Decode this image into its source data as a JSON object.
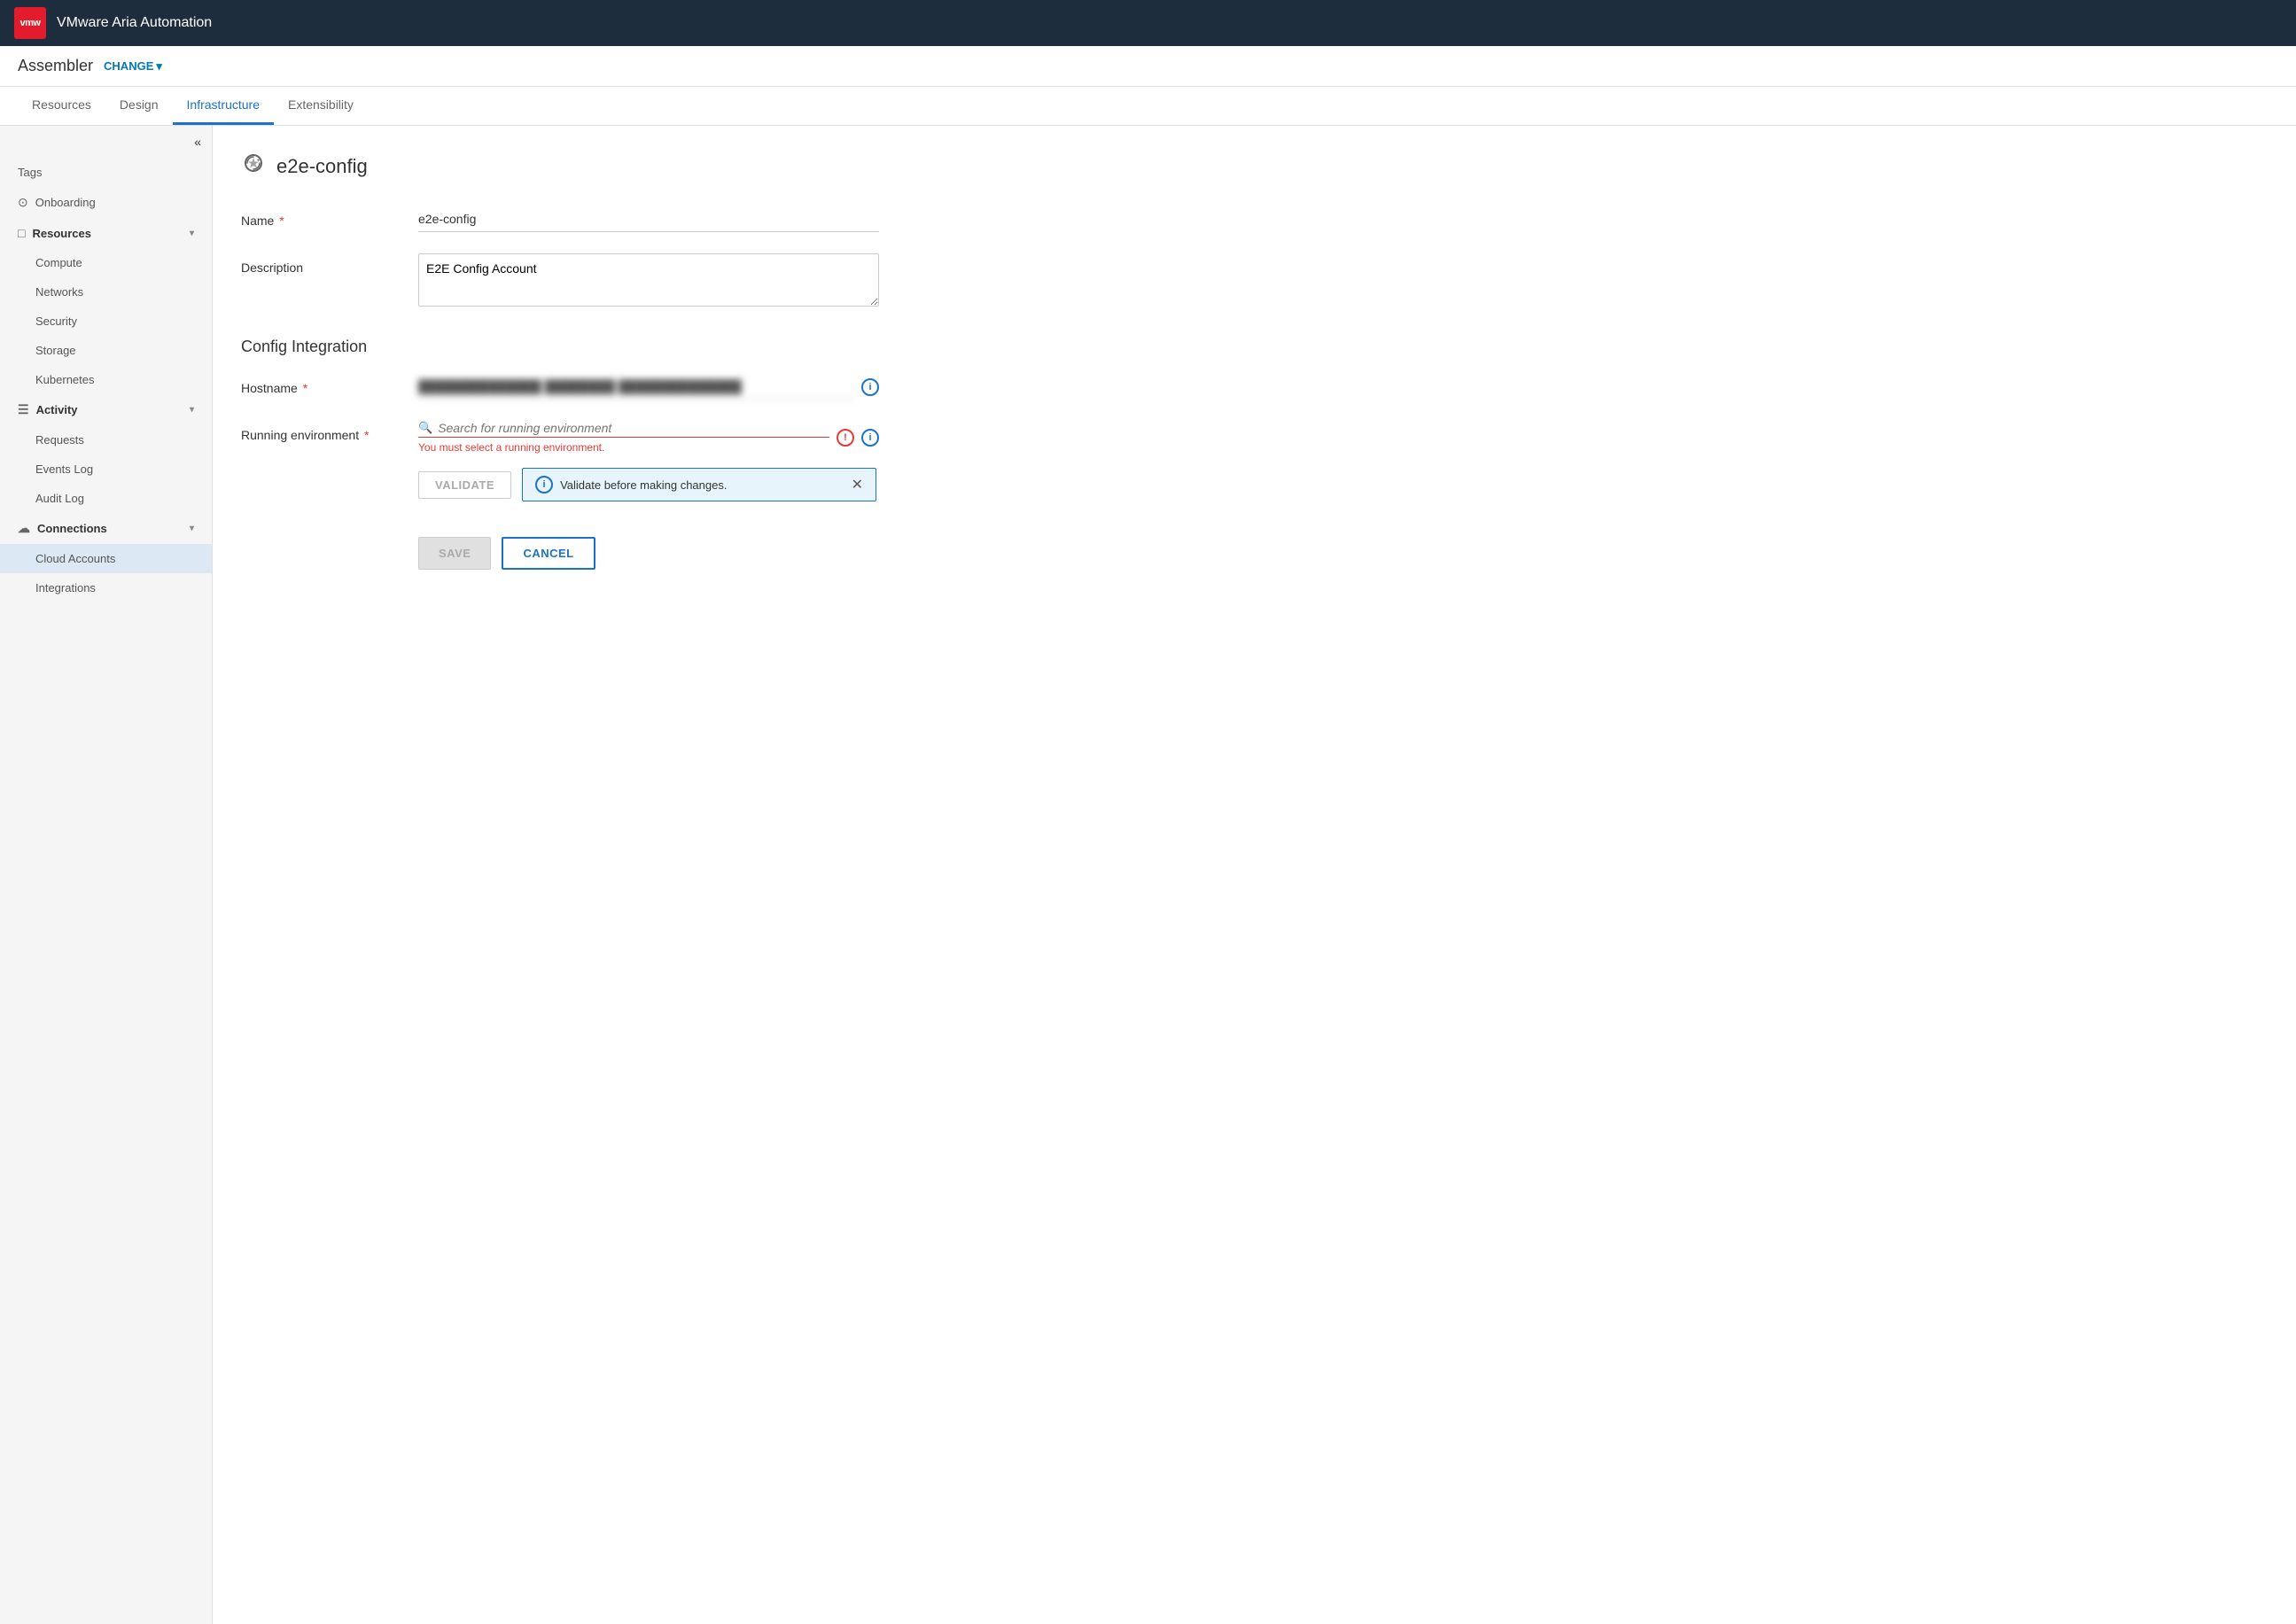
{
  "app": {
    "logo": "vmw",
    "title": "VMware Aria Automation"
  },
  "assembler": {
    "name": "Assembler",
    "change_label": "CHANGE",
    "chevron": "▾"
  },
  "nav_tabs": [
    {
      "id": "resources",
      "label": "Resources",
      "active": false
    },
    {
      "id": "design",
      "label": "Design",
      "active": false
    },
    {
      "id": "infrastructure",
      "label": "Infrastructure",
      "active": true
    },
    {
      "id": "extensibility",
      "label": "Extensibility",
      "active": false
    }
  ],
  "sidebar": {
    "collapse_icon": "«",
    "items": [
      {
        "id": "tags",
        "label": "Tags",
        "icon": "",
        "type": "item"
      },
      {
        "id": "onboarding",
        "label": "Onboarding",
        "icon": "⊙",
        "type": "item"
      },
      {
        "id": "resources",
        "label": "Resources",
        "icon": "□",
        "type": "header",
        "expanded": true
      },
      {
        "id": "compute",
        "label": "Compute",
        "type": "sub-item"
      },
      {
        "id": "networks",
        "label": "Networks",
        "type": "sub-item"
      },
      {
        "id": "security",
        "label": "Security",
        "type": "sub-item"
      },
      {
        "id": "storage",
        "label": "Storage",
        "type": "sub-item"
      },
      {
        "id": "kubernetes",
        "label": "Kubernetes",
        "type": "sub-item"
      },
      {
        "id": "activity",
        "label": "Activity",
        "icon": "☰",
        "type": "header",
        "expanded": true
      },
      {
        "id": "requests",
        "label": "Requests",
        "type": "sub-item"
      },
      {
        "id": "events-log",
        "label": "Events Log",
        "type": "sub-item"
      },
      {
        "id": "audit-log",
        "label": "Audit Log",
        "type": "sub-item"
      },
      {
        "id": "connections",
        "label": "Connections",
        "icon": "☁",
        "type": "header",
        "expanded": true
      },
      {
        "id": "cloud-accounts",
        "label": "Cloud Accounts",
        "type": "sub-item",
        "active": true
      },
      {
        "id": "integrations",
        "label": "Integrations",
        "type": "sub-item"
      }
    ]
  },
  "page": {
    "icon": "↻",
    "title": "e2e-config",
    "form": {
      "name_label": "Name",
      "name_required": true,
      "name_value": "e2e-config",
      "description_label": "Description",
      "description_value": "E2E Config Account",
      "section_title": "Config Integration",
      "hostname_label": "Hostname",
      "hostname_required": true,
      "hostname_blurred": "██████████ ████ ██████ ████ ████",
      "running_env_label": "Running environment",
      "running_env_required": true,
      "running_env_placeholder": "Search for running environment",
      "error_text": "You must select a running environment.",
      "validate_label": "VALIDATE",
      "validate_info": "Validate before making changes.",
      "save_label": "SAVE",
      "cancel_label": "CANCEL"
    }
  }
}
